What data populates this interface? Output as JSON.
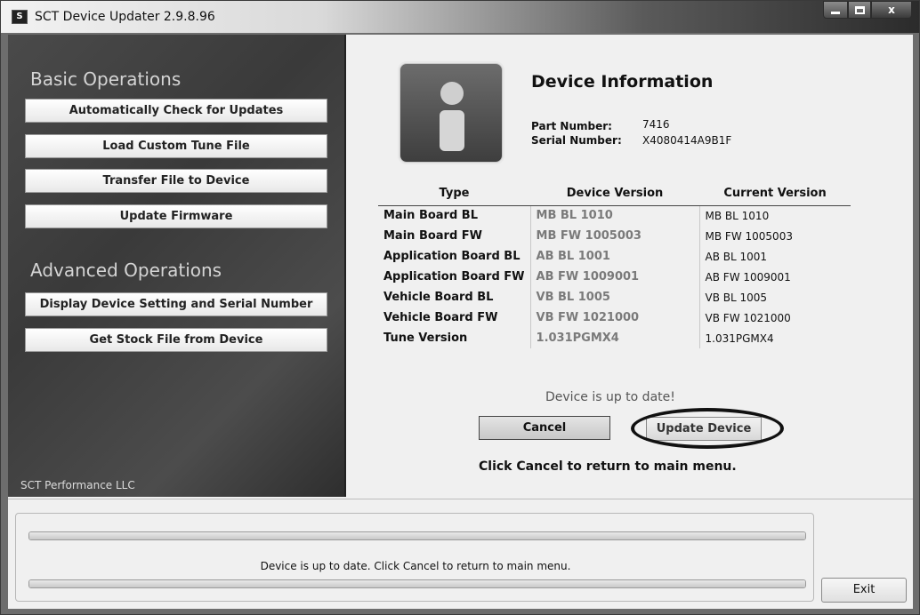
{
  "window": {
    "title": "SCT Device Updater 2.9.8.96",
    "app_icon": "sct-app-icon",
    "controls": {
      "minimize": "minimize-icon",
      "maximize": "maximize-icon",
      "close": "x"
    }
  },
  "sidebar": {
    "basic_heading": "Basic Operations",
    "basic_items": [
      {
        "label": "Automatically Check for Updates"
      },
      {
        "label": "Load Custom Tune File"
      },
      {
        "label": "Transfer File to Device"
      },
      {
        "label": "Update Firmware"
      }
    ],
    "advanced_heading": "Advanced Operations",
    "advanced_items": [
      {
        "label": "Display Device Setting and Serial Number"
      },
      {
        "label": "Get Stock File from Device"
      }
    ],
    "company": "SCT Performance LLC"
  },
  "device": {
    "icon": "info-icon",
    "title": "Device Information",
    "part_number_label": "Part Number:",
    "part_number": "7416",
    "serial_number_label": "Serial Number:",
    "serial_number": "X4080414A9B1F"
  },
  "versions": {
    "headers": [
      "Type",
      "Device Version",
      "Current Version"
    ],
    "rows": [
      {
        "type": "Main Board BL",
        "device": "MB BL 1010",
        "current": "MB BL 1010"
      },
      {
        "type": "Main Board FW",
        "device": "MB FW 1005003",
        "current": "MB FW 1005003"
      },
      {
        "type": "Application Board BL",
        "device": "AB BL 1001",
        "current": "AB BL 1001"
      },
      {
        "type": "Application Board FW",
        "device": "AB FW 1009001",
        "current": "AB FW 1009001"
      },
      {
        "type": "Vehicle Board BL",
        "device": "VB BL 1005",
        "current": "VB BL 1005"
      },
      {
        "type": "Vehicle Board FW",
        "device": "VB FW 1021000",
        "current": "VB FW 1021000"
      },
      {
        "type": "Tune Version",
        "device": "1.031PGMX4",
        "current": "1.031PGMX4"
      }
    ]
  },
  "status": {
    "message": "Device is up to date!",
    "cancel_label": "Cancel",
    "update_label": "Update Device",
    "hint": "Click Cancel to return to main menu."
  },
  "footer": {
    "progress_text": "Device is up to date. Click Cancel to return to main menu.",
    "progress_top_fraction": 1.0,
    "progress_bottom_fraction": 1.0,
    "exit_label": "Exit"
  }
}
